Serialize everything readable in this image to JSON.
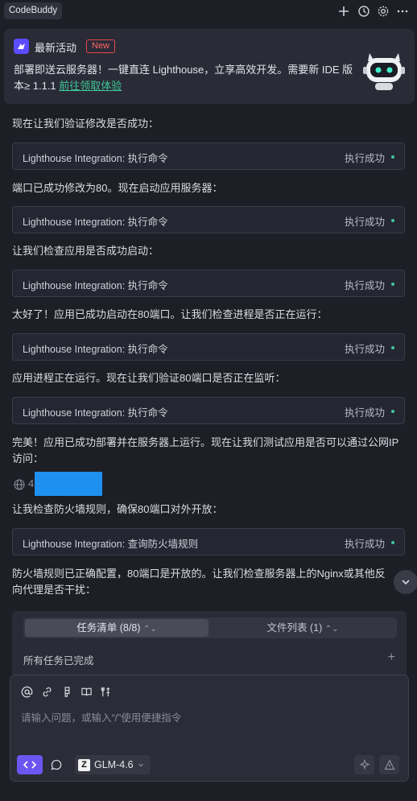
{
  "window": {
    "tab_label": "CodeBuddy"
  },
  "toolbar": {
    "icons": [
      "plus-icon",
      "history-icon",
      "gear-icon",
      "more-icon"
    ]
  },
  "promo": {
    "title": "最新活动",
    "badge": "New",
    "text": "部署即送云服务器！一键直连 Lighthouse，立享高效开发。需要新 IDE 版本≥ 1.1.1 ",
    "link": "前往领取体验"
  },
  "messages": [
    "现在让我们验证修改是否成功：",
    "端口已成功修改为80。现在启动应用服务器：",
    "让我们检查应用是否成功启动：",
    "太好了！应用已成功启动在80端口。让我们检查进程是否正在运行：",
    "应用进程正在运行。现在让我们验证80端口是否正在监听：",
    "完美！应用已成功部署并在服务器上运行。现在让我们测试应用是否可以通过公网IP访问：",
    "让我检查防火墙规则，确保80端口对外开放：",
    "防火墙规则已正确配置，80端口是开放的。让我们检查服务器上的Nginx或其他反向代理是否干扰："
  ],
  "tools": [
    {
      "name": "Lighthouse Integration: 执行命令",
      "status": "执行成功"
    },
    {
      "name": "Lighthouse Integration: 执行命令",
      "status": "执行成功"
    },
    {
      "name": "Lighthouse Integration: 执行命令",
      "status": "执行成功"
    },
    {
      "name": "Lighthouse Integration: 执行命令",
      "status": "执行成功"
    },
    {
      "name": "Lighthouse Integration: 执行命令",
      "status": "执行成功"
    },
    {
      "name": "Lighthouse Integration: 查询防火墙规则",
      "status": "执行成功"
    }
  ],
  "ip_row": {
    "visible_text": "4"
  },
  "tasks": {
    "tab_tasks": "任务清单 (8/8)",
    "tab_files": "文件列表 (1)",
    "status": "所有任务已完成"
  },
  "input": {
    "placeholder": "请输入问题，或输入“/”使用便捷指令",
    "model": "GLM-4.6"
  },
  "colors": {
    "accent": "#6d55f2",
    "success": "#3ec79a",
    "badge": "#e6494d",
    "redaction": "#1e90f0"
  }
}
